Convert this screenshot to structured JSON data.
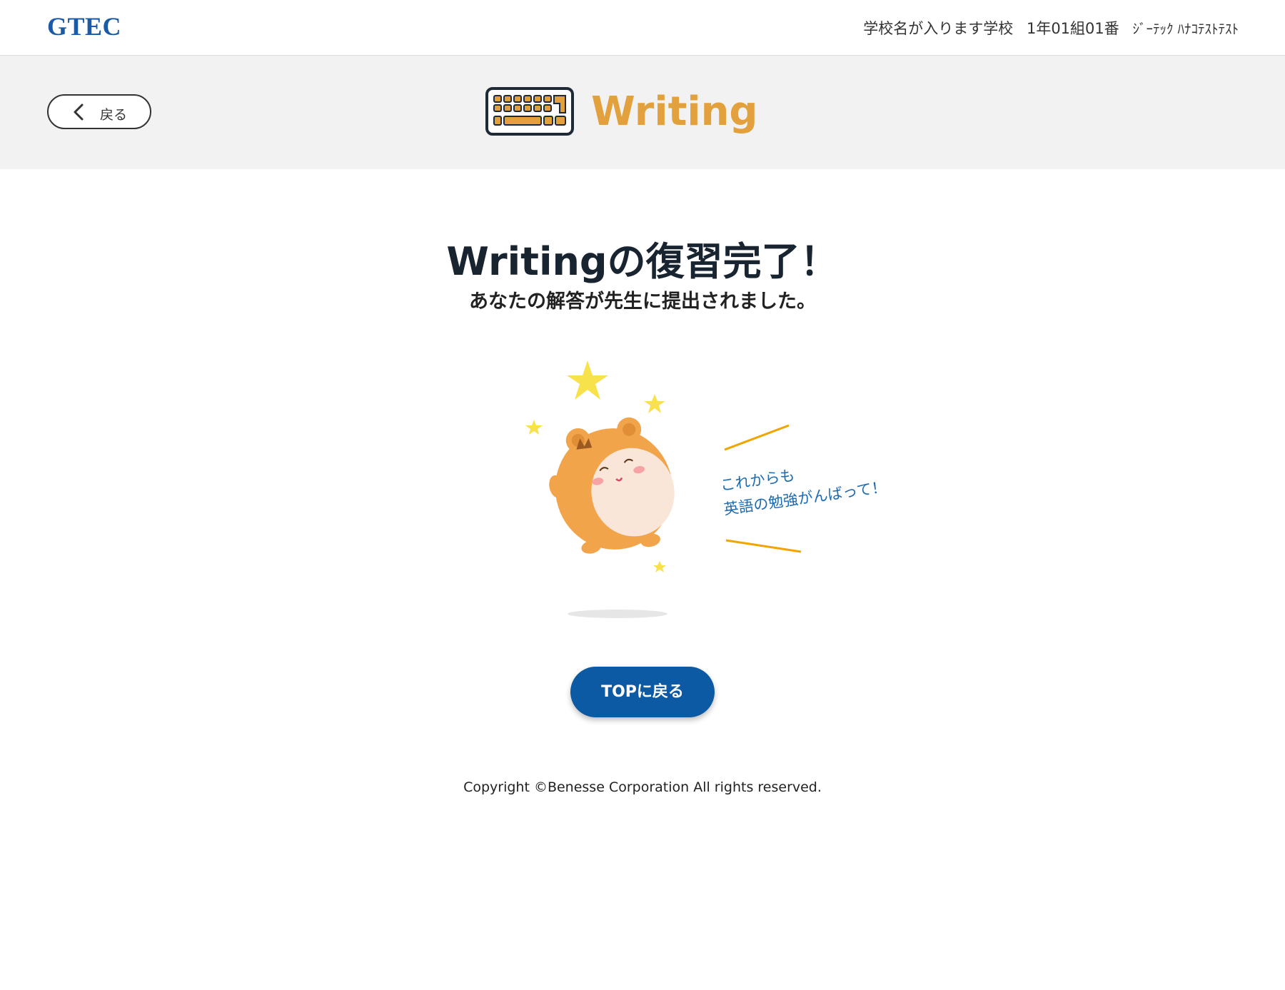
{
  "header": {
    "logo": "GTEC",
    "school": "学校名が入ります学校",
    "class_number": "1年01組01番",
    "student_name": "ｼﾞｰﾃｯｸ ﾊﾅｺﾃｽﾄﾃｽﾄ"
  },
  "subheader": {
    "back_label": "戻る",
    "section_title": "Writing",
    "section_icon": "keyboard-icon"
  },
  "main": {
    "heading": "Writingの復習完了！",
    "subtext": "あなたの解答が先生に提出されました。",
    "speech_line1": "これからも",
    "speech_line2": "英語の勉強がんばって！",
    "top_button_label": "TOPに戻る"
  },
  "footer": {
    "copyright": "Copyright ©Benesse Corporation All rights reserved."
  },
  "colors": {
    "brand_blue": "#1a5aa6",
    "button_blue": "#0b5aa3",
    "writing_accent": "#e2a13c",
    "speech_text": "#1e6bb0",
    "star_yellow": "#f7e24b"
  }
}
